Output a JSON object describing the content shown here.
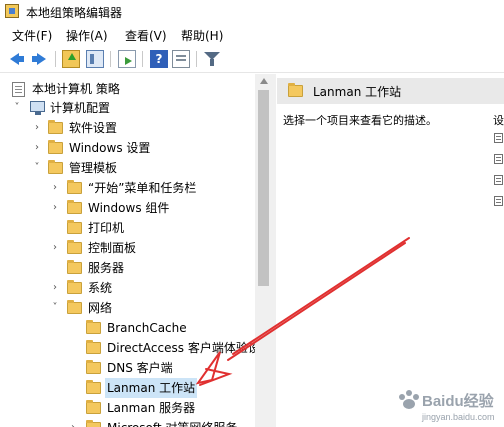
{
  "window": {
    "title": "本地组策略编辑器"
  },
  "menu": [
    {
      "label": "文件(F)"
    },
    {
      "label": "操作(A)"
    },
    {
      "label": "查看(V)"
    },
    {
      "label": "帮助(H)"
    }
  ],
  "toolbar": {
    "buttons": [
      "arrow-left-icon",
      "arrow-right-icon",
      "folder-up-icon",
      "show-tree-icon",
      "export-list-icon",
      "help-icon",
      "properties-icon",
      "filter-icon"
    ],
    "help_glyph": "?"
  },
  "tree": [
    {
      "label": "本地计算机 策略",
      "icon": "policy-icon",
      "twisty": ""
    },
    {
      "label": "计算机配置",
      "icon": "computer-icon",
      "twisty": "˅"
    },
    {
      "label": "软件设置",
      "icon": "folder-icon",
      "twisty": "›"
    },
    {
      "label": "Windows 设置",
      "icon": "folder-icon",
      "twisty": "›"
    },
    {
      "label": "管理模板",
      "icon": "folder-icon",
      "twisty": "˅"
    },
    {
      "label": "“开始”菜单和任务栏",
      "icon": "folder-icon",
      "twisty": "›"
    },
    {
      "label": "Windows 组件",
      "icon": "folder-icon",
      "twisty": "›"
    },
    {
      "label": "打印机",
      "icon": "folder-icon",
      "twisty": ""
    },
    {
      "label": "控制面板",
      "icon": "folder-icon",
      "twisty": "›"
    },
    {
      "label": "服务器",
      "icon": "folder-icon",
      "twisty": ""
    },
    {
      "label": "系统",
      "icon": "folder-icon",
      "twisty": "›"
    },
    {
      "label": "网络",
      "icon": "folder-icon",
      "twisty": "˅"
    },
    {
      "label": "BranchCache",
      "icon": "folder-icon",
      "twisty": ""
    },
    {
      "label": "DirectAccess 客户端体验设",
      "icon": "folder-icon",
      "twisty": ""
    },
    {
      "label": "DNS 客户端",
      "icon": "folder-icon",
      "twisty": ""
    },
    {
      "label": "Lanman 工作站",
      "icon": "folder-icon",
      "twisty": "",
      "selected": true
    },
    {
      "label": "Lanman 服务器",
      "icon": "folder-icon",
      "twisty": ""
    },
    {
      "label": "Microsoft 对等网络服务",
      "icon": "folder-icon",
      "twisty": "›"
    }
  ],
  "right_pane": {
    "title": "Lanman 工作站",
    "description": "选择一个项目来查看它的描述。",
    "settings_label": "设"
  },
  "watermark": {
    "text": "Baidu经验",
    "url": "jingyan.baidu.com"
  },
  "colors": {
    "selection": "#cce4f7",
    "annotation_arrow": "#e03030",
    "header_bg": "#e9e9e9"
  }
}
